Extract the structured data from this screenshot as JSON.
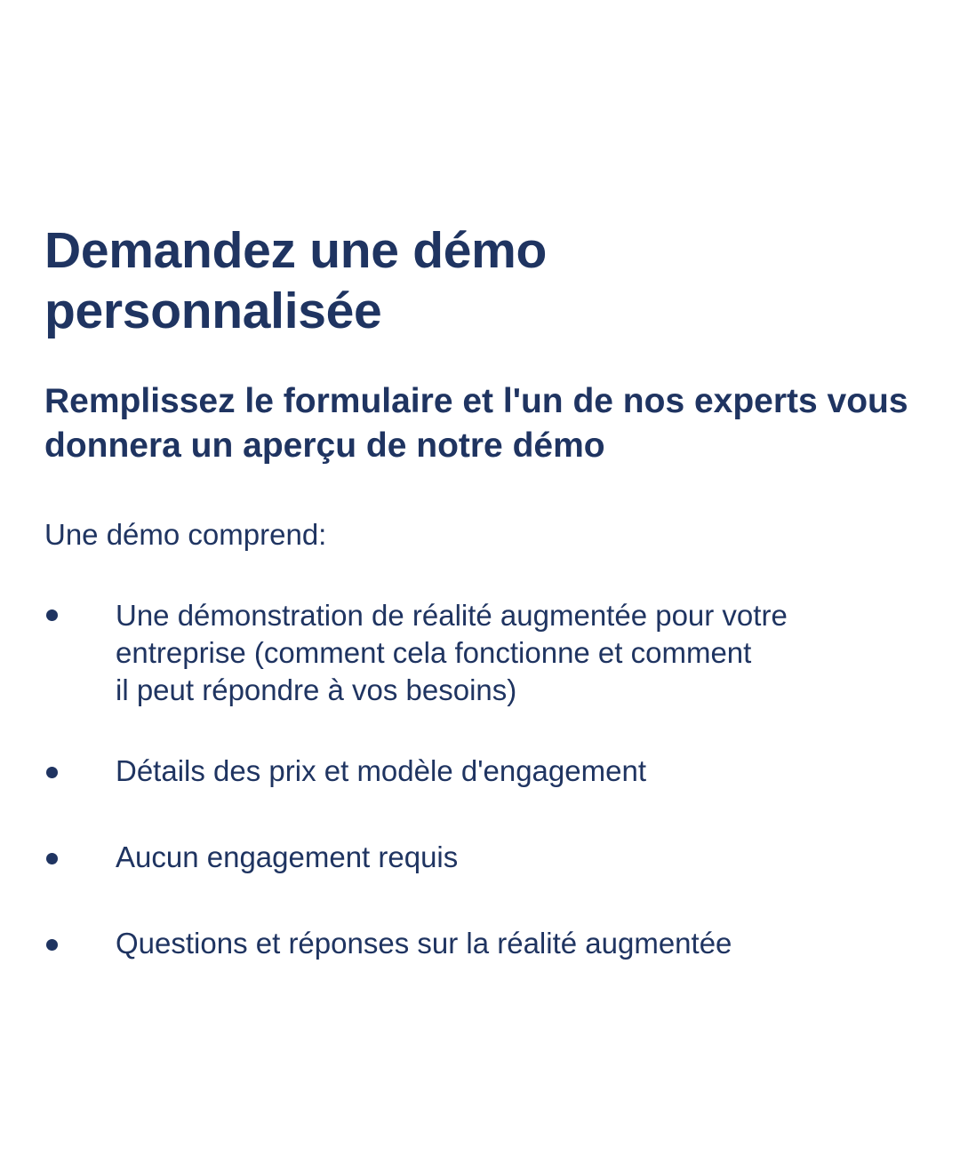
{
  "heading": {
    "title": "Demandez une démo personnalisée",
    "subtitle": "Remplissez le formulaire et l'un de nos experts vous donnera un aperçu de notre démo"
  },
  "intro": "Une démo comprend:",
  "items": [
    {
      "text": "Une démonstration de réalité augmentée pour votre\nentreprise (comment cela fonctionne et comment\nil peut répondre à vos besoins)"
    },
    {
      "text": "Détails des prix et modèle d'engagement"
    },
    {
      "text": "Aucun engagement requis"
    },
    {
      "text": "Questions et réponses sur la réalité augmentée"
    }
  ],
  "colors": {
    "text": "#1f3461",
    "background": "#ffffff"
  }
}
